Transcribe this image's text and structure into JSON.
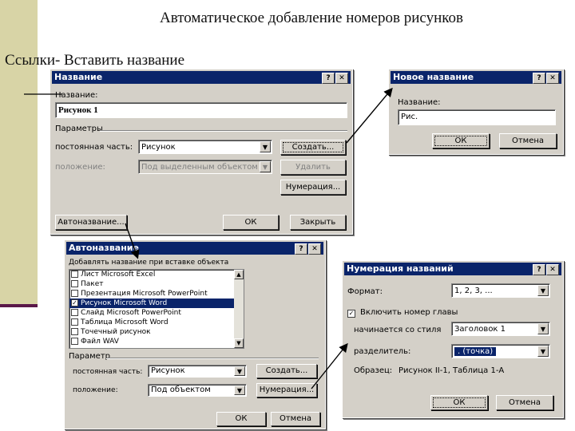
{
  "slide": {
    "title": "Автоматическое добавление номеров рисунков",
    "note": "Ссылки- Вставить название"
  },
  "dialog_caption": {
    "title": "Название",
    "help": "?",
    "close": "✕",
    "caption_label": "Название:",
    "caption_value": "Рисунок 1",
    "params_label": "Параметры",
    "label_label": "постоянная часть:",
    "label_value": "Рисунок",
    "position_label": "положение:",
    "position_value": "Под выделенным объектом",
    "new_label_btn": "Создать...",
    "delete_btn": "Удалить",
    "numbering_btn": "Нумерация...",
    "autocaption_btn": "Автоназвание...",
    "ok_btn": "ОК",
    "close_btn": "Закрыть"
  },
  "dialog_new": {
    "title": "Новое название",
    "help": "?",
    "close": "✕",
    "label": "Название:",
    "value": "Рис.",
    "ok_btn": "ОК",
    "cancel_btn": "Отмена"
  },
  "dialog_auto": {
    "title": "Автоназвание",
    "help": "?",
    "close": "✕",
    "list_label": "Добавлять название при вставке объекта",
    "items": [
      {
        "label": "Лист Microsoft Excel",
        "checked": false,
        "selected": false
      },
      {
        "label": "Пакет",
        "checked": false,
        "selected": false
      },
      {
        "label": "Презентация Microsoft PowerPoint",
        "checked": false,
        "selected": false
      },
      {
        "label": "Рисунок Microsoft Word",
        "checked": true,
        "selected": true
      },
      {
        "label": "Слайд Microsoft PowerPoint",
        "checked": false,
        "selected": false
      },
      {
        "label": "Таблица Microsoft Word",
        "checked": false,
        "selected": false
      },
      {
        "label": "Точечный рисунок",
        "checked": false,
        "selected": false
      },
      {
        "label": "Файл WAV",
        "checked": false,
        "selected": false
      }
    ],
    "param_label": "Параметр",
    "label_label": "постоянная часть:",
    "label_value": "Рисунок",
    "position_label": "положение:",
    "position_value": "Под объектом",
    "new_btn": "Создать...",
    "numbering_btn": "Нумерация...",
    "ok_btn": "ОК",
    "cancel_btn": "Отмена"
  },
  "dialog_numbering": {
    "title": "Нумерация названий",
    "help": "?",
    "close": "✕",
    "format_label": "Формат:",
    "format_value": "1, 2, 3, ...",
    "chapter_label": "Включить номер главы",
    "chapter_checked": true,
    "style_label": "начинается со стиля",
    "style_value": "Заголовок 1",
    "separator_label": "разделитель:",
    "separator_value": ". (точка)",
    "example_label": "Образец:",
    "example_value": "Рисунок II-1, Таблица 1-А",
    "ok_btn": "ОК",
    "cancel_btn": "Отмена"
  },
  "colors": {
    "titlebar": "#0a246a",
    "dialog_bg": "#d4d0c8",
    "side_bar": "#d8d4a6",
    "accent_line": "#5a1848"
  }
}
